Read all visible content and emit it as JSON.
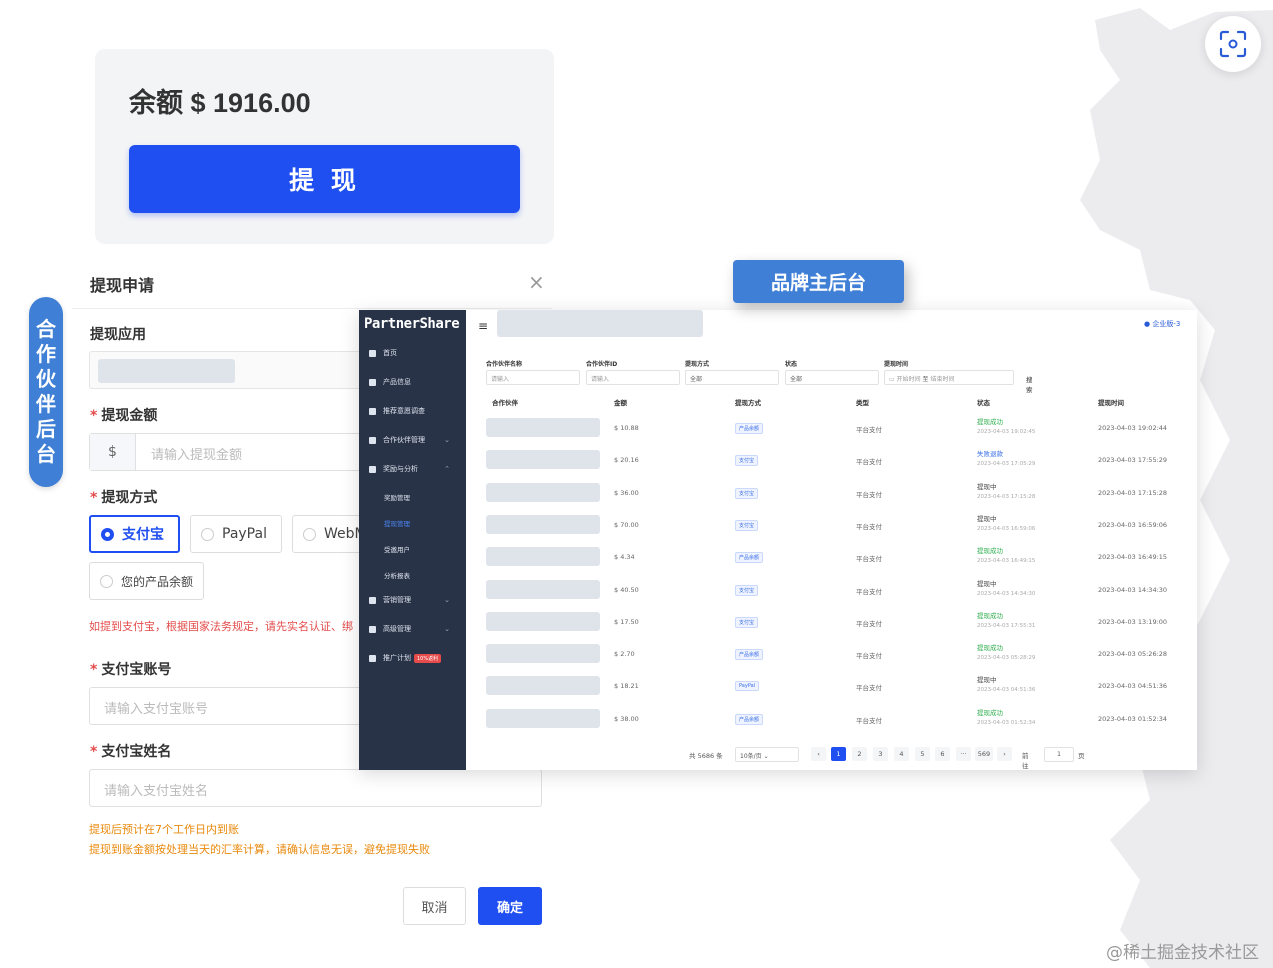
{
  "balance": {
    "text": "余额 $ 1916.00",
    "withdraw_label": "提 现"
  },
  "labels": {
    "partner": [
      "合",
      "作",
      "伙",
      "伴",
      "后",
      "台"
    ],
    "brand": "品牌主后台"
  },
  "dialog": {
    "title": "提现申请",
    "close_icon": "×",
    "app_label": "提现应用",
    "amount_label": "提现金额",
    "amount_prefix": "$",
    "amount_placeholder": "请输入提现金额",
    "method_label": "提现方式",
    "methods": [
      "支付宝",
      "PayPal",
      "WebM",
      "您的产品余额"
    ],
    "selected_method": "支付宝",
    "warning": "如提到支付宝，根据国家法务规定，请先实名认证、绑",
    "account_label": "支付宝账号",
    "account_placeholder": "请输入支付宝账号",
    "name_label": "支付宝姓名",
    "name_placeholder": "请输入支付宝姓名",
    "note1": "提现后预计在7个工作日内到账",
    "note2": "提现到账金额按处理当天的汇率计算，请确认信息无误，避免提现失败",
    "cancel": "取消",
    "confirm": "确定"
  },
  "admin": {
    "logo": "PartnerShare",
    "menu_icon": "≡",
    "user": "● 企业版-3",
    "sidebar": {
      "home": "首页",
      "product": "产品信息",
      "recommend": "推荐意愿调查",
      "partners": "合作伙伴管理",
      "rewards": "奖励与分析",
      "sub_reward": "奖励管理",
      "sub_withdraw": "提现管理",
      "sub_users": "受邀用户",
      "sub_report": "分析报表",
      "marketing": "营销管理",
      "advanced": "高级管理",
      "promo": "推广计划",
      "promo_tag": "10%返利"
    },
    "filters": {
      "partner_name": "合作伙伴名称",
      "partner_id": "合作伙伴ID",
      "method": "提现方式",
      "status": "状态",
      "time": "提现时间",
      "ph_input": "请输入",
      "all": "全部",
      "start": "开始时间",
      "to": "至",
      "end": "结束时间",
      "search": "搜索"
    },
    "columns": [
      "合作伙伴",
      "金额",
      "提现方式",
      "类型",
      "状态",
      "提现时间"
    ],
    "rows": [
      {
        "amount": "$ 10.88",
        "method": "产品余额",
        "type": "平台支付",
        "status": "提现成功",
        "status_color": "#2fae4e",
        "status_time": "2023-04-03 19:02:45",
        "time": "2023-04-03 19:02:44"
      },
      {
        "amount": "$ 20.16",
        "method": "支付宝",
        "type": "平台支付",
        "status": "失败退款",
        "status_color": "#3a6ee8",
        "status_time": "2023-04-03 17:05:29",
        "time": "2023-04-03 17:55:29"
      },
      {
        "amount": "$ 36.00",
        "method": "支付宝",
        "type": "平台支付",
        "status": "提现中",
        "status_color": "#444444",
        "status_time": "2023-04-03 17:15:28",
        "time": "2023-04-03 17:15:28"
      },
      {
        "amount": "$ 70.00",
        "method": "支付宝",
        "type": "平台支付",
        "status": "提现中",
        "status_color": "#444444",
        "status_time": "2023-04-03 16:59:06",
        "time": "2023-04-03 16:59:06"
      },
      {
        "amount": "$ 4.34",
        "method": "产品余额",
        "type": "平台支付",
        "status": "提现成功",
        "status_color": "#2fae4e",
        "status_time": "2023-04-03 16:49:15",
        "time": "2023-04-03 16:49:15"
      },
      {
        "amount": "$ 40.50",
        "method": "支付宝",
        "type": "平台支付",
        "status": "提现中",
        "status_color": "#444444",
        "status_time": "2023-04-03 14:34:30",
        "time": "2023-04-03 14:34:30"
      },
      {
        "amount": "$ 17.50",
        "method": "支付宝",
        "type": "平台支付",
        "status": "提现成功",
        "status_color": "#2fae4e",
        "status_time": "2023-04-03 17:55:31",
        "time": "2023-04-03 13:19:00"
      },
      {
        "amount": "$ 2.70",
        "method": "产品余额",
        "type": "平台支付",
        "status": "提现成功",
        "status_color": "#2fae4e",
        "status_time": "2023-04-03 05:28:29",
        "time": "2023-04-03 05:26:28"
      },
      {
        "amount": "$ 18.21",
        "method": "PayPal",
        "type": "平台支付",
        "status": "提现中",
        "status_color": "#444444",
        "status_time": "2023-04-03 04:51:36",
        "time": "2023-04-03 04:51:36"
      },
      {
        "amount": "$ 38.00",
        "method": "产品余额",
        "type": "平台支付",
        "status": "提现成功",
        "status_color": "#2fae4e",
        "status_time": "2023-04-03 01:52:34",
        "time": "2023-04-03 01:52:34"
      }
    ],
    "pager": {
      "total": "共 5686 条",
      "page_size": "10条/页",
      "pages": [
        "1",
        "2",
        "3",
        "4",
        "5",
        "6",
        "···",
        "569"
      ],
      "goto": "前往",
      "goto_value": "1",
      "page_unit": "页"
    }
  },
  "watermark": "@稀土掘金技术社区"
}
